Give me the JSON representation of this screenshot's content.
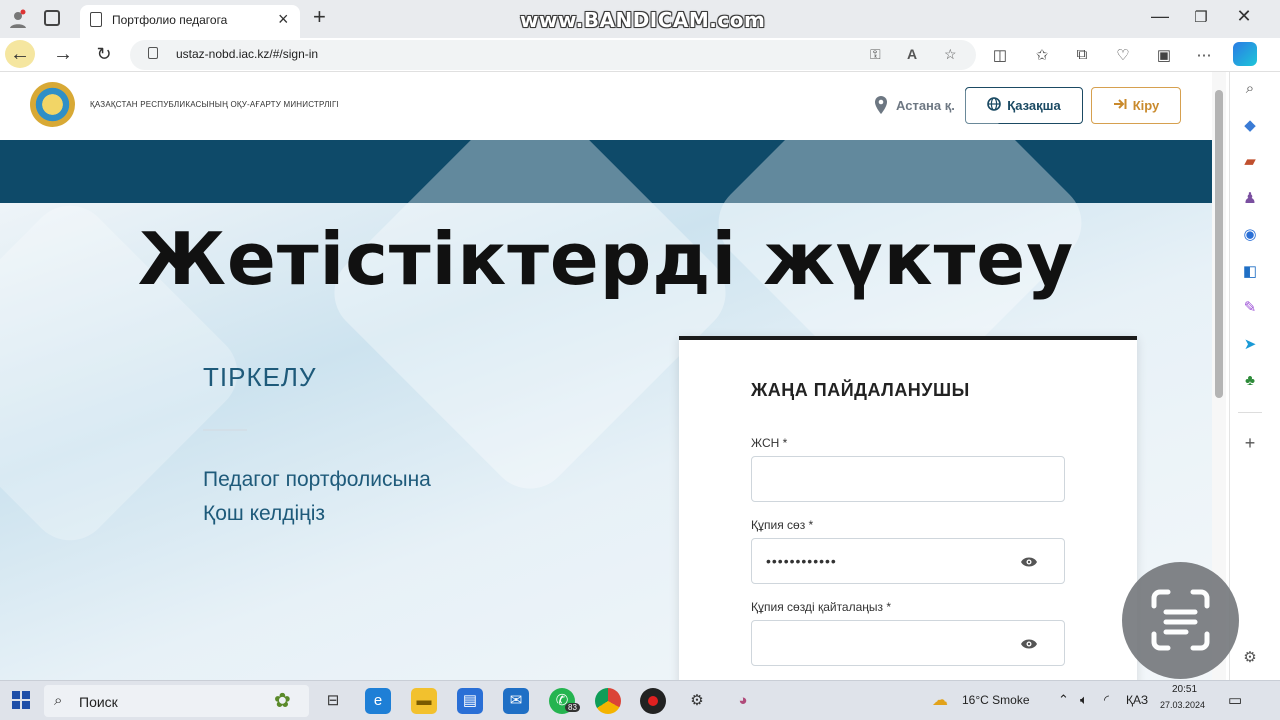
{
  "browser": {
    "tab_title": "Портфолио педагога",
    "watermark": "www.BANDICAM.com",
    "url": "ustaz-nobd.iac.kz/#/sign-in",
    "window_controls": [
      "—",
      "❐",
      "✕"
    ]
  },
  "site": {
    "ministry_name": "ҚАЗАҚСТАН РЕСПУБЛИКАСЫНЫҢ ОҚУ-АҒАРТУ МИНИСТРЛІГІ",
    "location": "Астана қ.",
    "language_button": "Қазақша",
    "login_button": "Кіру",
    "colors": {
      "band": "#0e4a69",
      "accent": "#1e5a7a",
      "login": "#c98a2c"
    }
  },
  "overlay": {
    "title": "Жетістіктерді жүктеу"
  },
  "hero": {
    "register_title": "ТІРКЕЛУ",
    "welcome_line1": "Педагог портфолисына",
    "welcome_line2": "Қош келдіңіз"
  },
  "form": {
    "heading": "ЖАҢА ПАЙДАЛАНУШЫ",
    "iin_label": "ЖСН *",
    "iin_value": "",
    "password_label": "Құпия сөз *",
    "password_value": "••••••••••••",
    "password_repeat_label": "Құпия сөзді қайталаңыз *",
    "password_repeat_value": ""
  },
  "taskbar": {
    "search_placeholder": "Поиск",
    "weather": "16°C  Smoke",
    "language": "ҚАЗ",
    "time": "20:51",
    "date": "27.03.2024",
    "badge": "83"
  }
}
